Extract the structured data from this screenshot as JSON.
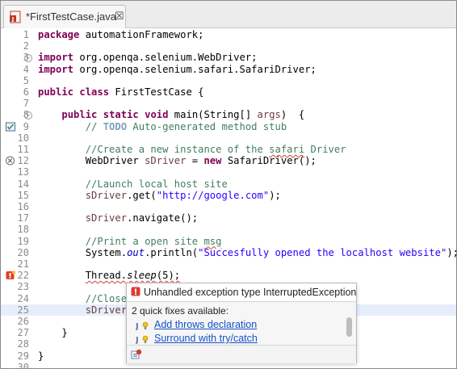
{
  "editor_tab": {
    "title": "*FirstTestCase.java",
    "close": "☒"
  },
  "colors": {
    "keyword": "#7f0055",
    "comment": "#3f7f5f",
    "string": "#2a00ff",
    "error": "#d83a3a",
    "link": "#1650c8",
    "current_line": "#e6eefb"
  },
  "code": {
    "lines": [
      {
        "num": "1",
        "seg": [
          {
            "t": "package",
            "c": "kw"
          },
          {
            "t": " automationFramework;"
          }
        ]
      },
      {
        "num": "2",
        "seg": []
      },
      {
        "num": "3",
        "fold": true,
        "seg": [
          {
            "t": "import",
            "c": "kw"
          },
          {
            "t": " org.openqa.selenium.WebDriver;"
          }
        ]
      },
      {
        "num": "4",
        "seg": [
          {
            "t": "import",
            "c": "kw"
          },
          {
            "t": " org.openqa.selenium.safari.SafariDriver;"
          }
        ]
      },
      {
        "num": "5",
        "seg": []
      },
      {
        "num": "6",
        "seg": [
          {
            "t": "public",
            "c": "kw"
          },
          {
            "t": " "
          },
          {
            "t": "class",
            "c": "kw"
          },
          {
            "t": " FirstTestCase {"
          }
        ]
      },
      {
        "num": "7",
        "seg": []
      },
      {
        "num": "8",
        "fold": true,
        "seg": [
          {
            "t": "    "
          },
          {
            "t": "public",
            "c": "kw"
          },
          {
            "t": " "
          },
          {
            "t": "static",
            "c": "kw"
          },
          {
            "t": " "
          },
          {
            "t": "void",
            "c": "kw"
          },
          {
            "t": " main(String[] "
          },
          {
            "t": "args",
            "c": "var"
          },
          {
            "t": ")  {"
          }
        ]
      },
      {
        "num": "9",
        "icon": "task",
        "seg": [
          {
            "t": "        "
          },
          {
            "t": "// ",
            "c": "cm"
          },
          {
            "t": "TODO",
            "c": "todo"
          },
          {
            "t": " Auto-generated method stub",
            "c": "cm"
          }
        ]
      },
      {
        "num": "10",
        "seg": []
      },
      {
        "num": "11",
        "seg": [
          {
            "t": "        //Create a new instance of the ",
            "c": "cm"
          },
          {
            "t": "safari",
            "c": "cm squig"
          },
          {
            "t": " Driver",
            "c": "cm"
          }
        ]
      },
      {
        "num": "12",
        "icon": "warning",
        "seg": [
          {
            "t": "        WebDriver "
          },
          {
            "t": "sDriver",
            "c": "var"
          },
          {
            "t": " = "
          },
          {
            "t": "new",
            "c": "kw"
          },
          {
            "t": " SafariDriver();"
          }
        ]
      },
      {
        "num": "13",
        "seg": []
      },
      {
        "num": "14",
        "seg": [
          {
            "t": "        //Launch local host site",
            "c": "cm"
          }
        ]
      },
      {
        "num": "15",
        "seg": [
          {
            "t": "        "
          },
          {
            "t": "sDriver",
            "c": "var"
          },
          {
            "t": ".get("
          },
          {
            "t": "\"http://google.com\"",
            "c": "str"
          },
          {
            "t": ");"
          }
        ]
      },
      {
        "num": "16",
        "seg": []
      },
      {
        "num": "17",
        "seg": [
          {
            "t": "        "
          },
          {
            "t": "sDriver",
            "c": "var"
          },
          {
            "t": ".navigate();"
          }
        ]
      },
      {
        "num": "18",
        "seg": []
      },
      {
        "num": "19",
        "seg": [
          {
            "t": "        //Print a open site ",
            "c": "cm"
          },
          {
            "t": "msg",
            "c": "cm squig"
          }
        ]
      },
      {
        "num": "20",
        "seg": [
          {
            "t": "        System."
          },
          {
            "t": "out",
            "c": "fld"
          },
          {
            "t": ".println("
          },
          {
            "t": "\"Succesfully opened the localhost website\"",
            "c": "str"
          },
          {
            "t": ");"
          }
        ]
      },
      {
        "num": "21",
        "seg": []
      },
      {
        "num": "22",
        "icon": "error",
        "seg": [
          {
            "t": "        "
          },
          {
            "t": "Thread.",
            "c": "squig"
          },
          {
            "t": "sleep",
            "c": "it squig"
          },
          {
            "t": "(5);",
            "c": "squig"
          }
        ]
      },
      {
        "num": "23",
        "seg": []
      },
      {
        "num": "24",
        "seg": [
          {
            "t": "        //Close",
            "c": "cm"
          }
        ]
      },
      {
        "num": "25",
        "current": true,
        "seg": [
          {
            "t": "        "
          },
          {
            "t": "sDriver",
            "c": "var"
          }
        ]
      },
      {
        "num": "26",
        "seg": []
      },
      {
        "num": "27",
        "seg": [
          {
            "t": "    }"
          }
        ]
      },
      {
        "num": "28",
        "seg": []
      },
      {
        "num": "29",
        "seg": [
          {
            "t": "}"
          }
        ]
      },
      {
        "num": "30",
        "seg": []
      }
    ]
  },
  "quickfix": {
    "title": "Unhandled exception type InterruptedException",
    "subtitle": "2 quick fixes available:",
    "fixes": [
      {
        "label": "Add throws declaration",
        "icon": "quick-fix-icon"
      },
      {
        "label": "Surround with try/catch",
        "icon": "quick-fix-icon"
      }
    ],
    "footer_icon": "configure-problem-severity-icon"
  }
}
